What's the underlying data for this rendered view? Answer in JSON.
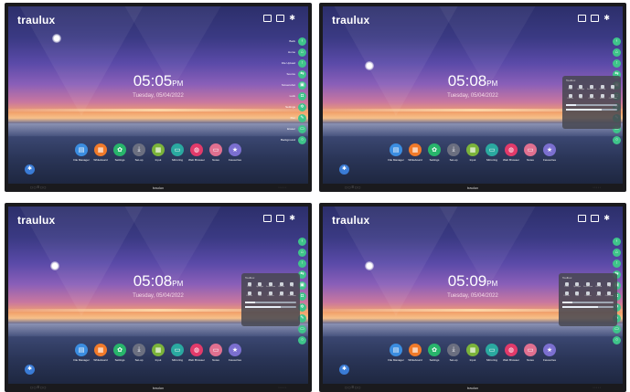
{
  "logo_text": "traulux",
  "bezel_brand": "traulux",
  "panels": [
    {
      "time": "05:05",
      "ampm": "PM",
      "date": "Tuesday, 05/04/2022",
      "toolbox": false
    },
    {
      "time": "05:08",
      "ampm": "PM",
      "date": "Tuesday, 05/04/2022",
      "toolbox": true
    },
    {
      "time": "05:08",
      "ampm": "PM",
      "date": "Tuesday, 05/04/2022",
      "toolbox": true
    },
    {
      "time": "05:09",
      "ampm": "PM",
      "date": "Tuesday, 05/04/2022",
      "toolbox": true
    }
  ],
  "dock_apps": [
    {
      "label": "File Manager",
      "icon": "file-icon",
      "color": "#3b8de0"
    },
    {
      "label": "Whiteboard",
      "icon": "board-icon",
      "color": "#f07a2a"
    },
    {
      "label": "Settings",
      "icon": "settings-icon",
      "color": "#28b56b"
    },
    {
      "label": "Set-up",
      "icon": "download-icon",
      "color": "#6b6f80"
    },
    {
      "label": "Input",
      "icon": "grid-icon",
      "color": "#7bb33a"
    },
    {
      "label": "Mirroring",
      "icon": "cast-icon",
      "color": "#2aa9a0"
    },
    {
      "label": "Web Browser",
      "icon": "globe-icon",
      "color": "#e23a6a"
    },
    {
      "label": "Notes",
      "icon": "note-icon",
      "color": "#e07090"
    },
    {
      "label": "Favourites",
      "icon": "star-icon",
      "color": "#7b6fd0"
    }
  ],
  "sidebar_labels": [
    "Back",
    "Home",
    "File Upload",
    "Source",
    "Screenshot",
    "Lock",
    "Settings",
    "Pen",
    "Eraser",
    "Background"
  ],
  "toolbox_title": "Toolbox",
  "toolbox_items": [
    "Timer",
    "Spotlight",
    "Screenshot",
    "Record",
    "Pen",
    "Freeze",
    "Vote",
    "Camera",
    "Mirror",
    "Calculator"
  ],
  "bezel_left": "▢ ▢ ☰ ▢ ▢",
  "bezel_right": "◦ ◦ ◦ ◦ ◦"
}
